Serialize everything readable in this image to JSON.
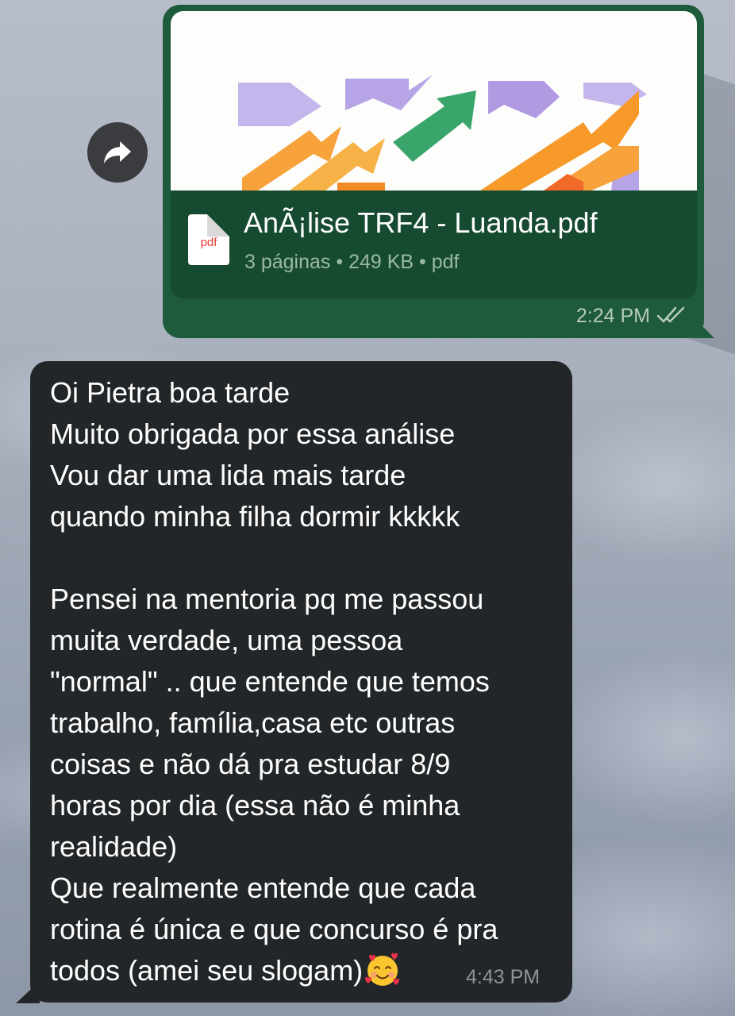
{
  "colors": {
    "outgoing_bubble": "#1e5a3c",
    "incoming_bubble": "#232628",
    "read_ticks": "#b6cbbd"
  },
  "forward_button": {
    "icon": "forward-arrow-icon"
  },
  "attachment": {
    "file_name": "AnÃ¡lise TRF4 - Luanda.pdf",
    "file_icon_label": "pdf",
    "meta": "3 páginas • 249 KB • pdf",
    "time": "2:24 PM",
    "status_icon": "double-check-icon"
  },
  "reply": {
    "lines": [
      "Oi Pietra boa tarde",
      "Muito obrigada por essa análise",
      "Vou dar uma lida mais tarde",
      "quando minha filha dormir kkkkk",
      "",
      "Pensei na mentoria pq me passou",
      "muita verdade,  uma pessoa",
      "\"normal\" .. que entende que temos",
      "trabalho, família,casa etc outras",
      "coisas e não dá pra estudar 8/9",
      "horas por dia (essa não é minha",
      "realidade)",
      "Que realmente entende que cada",
      "rotina é única e que concurso é pra",
      "todos (amei seu slogam)"
    ],
    "emoji": "smiling-face-with-hearts-icon",
    "time": "4:43 PM"
  }
}
